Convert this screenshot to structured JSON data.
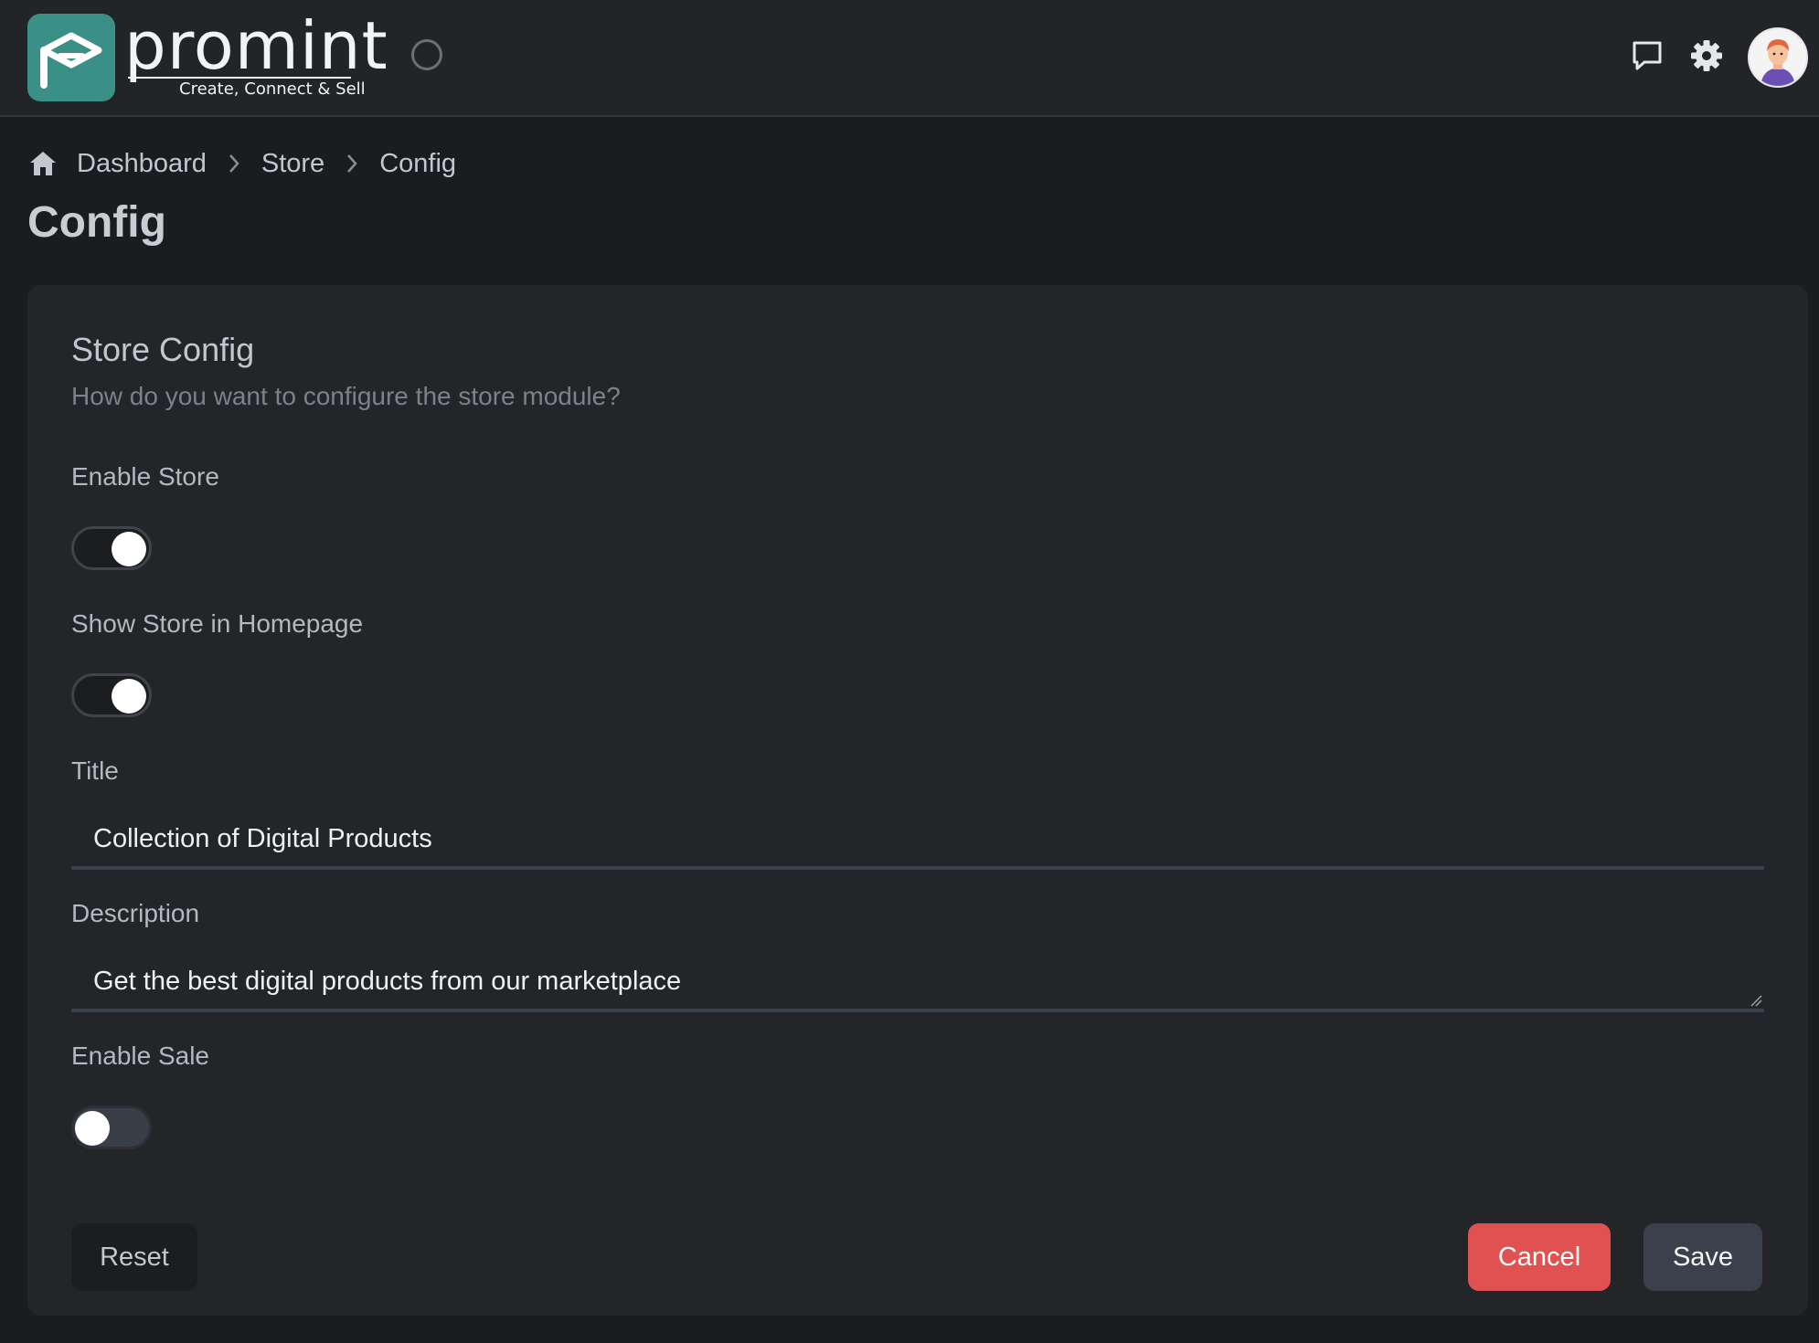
{
  "header": {
    "logo_text": "promint",
    "logo_tagline": "Create, Connect & Sell",
    "icons": [
      "spinner-icon",
      "chat-icon",
      "gear-icon",
      "avatar"
    ]
  },
  "breadcrumb": {
    "items": [
      "Dashboard",
      "Store",
      "Config"
    ]
  },
  "page": {
    "title": "Config"
  },
  "card": {
    "title": "Store Config",
    "subtitle": "How do you want to configure the store module?",
    "enable_store": {
      "label": "Enable Store",
      "on": true
    },
    "show_homepage": {
      "label": "Show Store in Homepage",
      "on": true
    },
    "title_field": {
      "label": "Title",
      "value": "Collection of Digital Products"
    },
    "description_field": {
      "label": "Description",
      "value": "Get the best digital products from our marketplace"
    },
    "enable_sale": {
      "label": "Enable Sale",
      "on": false
    },
    "buttons": {
      "reset": "Reset",
      "cancel": "Cancel",
      "save": "Save"
    }
  },
  "colors": {
    "background": "#1a1c20",
    "card": "#232528",
    "brand": "#3a8f87",
    "cancel": "#e05252",
    "save": "#3b404c"
  }
}
